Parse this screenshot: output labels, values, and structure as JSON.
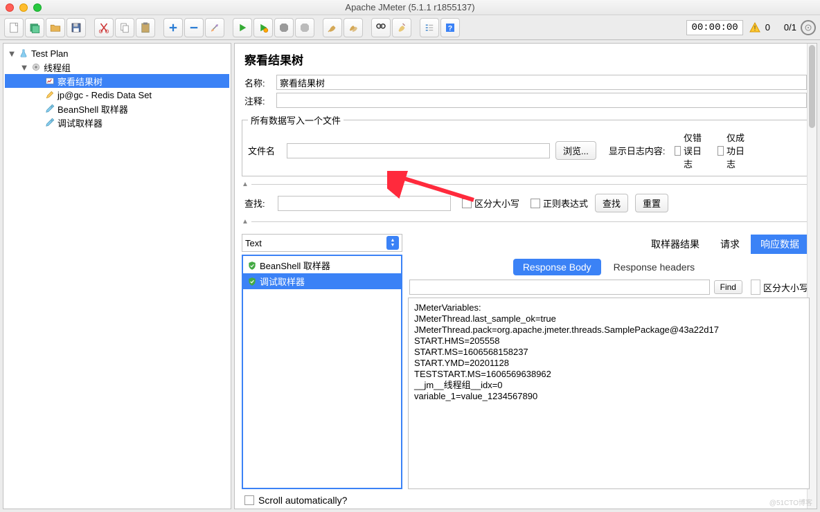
{
  "window": {
    "title": "Apache JMeter (5.1.1 r1855137)"
  },
  "toolbar": {
    "timer": "00:00:00",
    "warn_count": "0",
    "thread_count": "0/1"
  },
  "tree": {
    "testplan": "Test Plan",
    "threadgroup": "线程组",
    "viewresults": "察看结果树",
    "redis": "jp@gc - Redis Data Set",
    "beanshell": "BeanShell 取样器",
    "debug": "调试取样器"
  },
  "panel": {
    "title": "察看结果树",
    "name_label": "名称:",
    "name_value": "察看结果树",
    "comment_label": "注释:",
    "writefile_legend": "所有数据写入一个文件",
    "filename_label": "文件名",
    "browse_btn": "浏览...",
    "showlog_label": "显示日志内容:",
    "only_error": "仅错误日志",
    "only_success": "仅成功日志",
    "search_label": "查找:",
    "case_sensitive": "区分大小写",
    "regex": "正则表达式",
    "search_btn": "查找",
    "reset_btn": "重置",
    "combo_text": "Text",
    "samples": {
      "s1": "BeanShell 取样器",
      "s2": "调试取样器"
    },
    "tabs": {
      "sampler": "取样器结果",
      "request": "请求",
      "response": "响应数据"
    },
    "subtabs": {
      "body": "Response Body",
      "headers": "Response headers"
    },
    "find_btn": "Find",
    "find_case": "区分大小写",
    "response_text": "JMeterVariables:\nJMeterThread.last_sample_ok=true\nJMeterThread.pack=org.apache.jmeter.threads.SamplePackage@43a22d17\nSTART.HMS=205558\nSTART.MS=1606568158237\nSTART.YMD=20201128\nTESTSTART.MS=1606569638962\n__jm__线程组__idx=0\nvariable_1=value_1234567890",
    "scroll_auto": "Scroll automatically?"
  },
  "watermark": "@51CTO博客"
}
